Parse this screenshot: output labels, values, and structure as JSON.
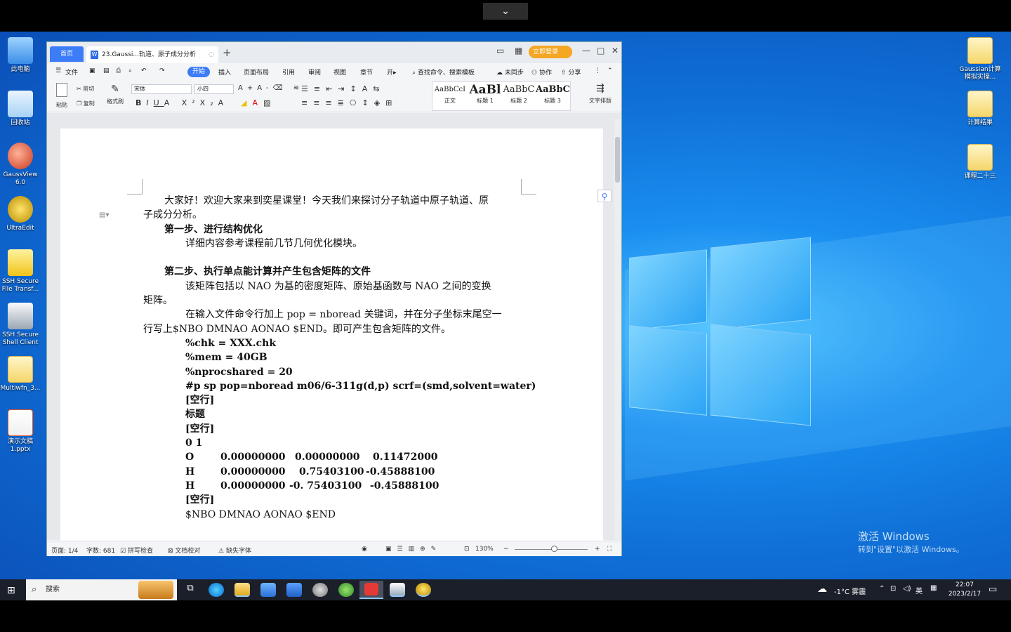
{
  "topbar": {
    "toggle_icon": "chevron-down-icon",
    "toggle_glyph": "⌄"
  },
  "desktop": {
    "icons_left": [
      {
        "label": "此电脑",
        "icon": "computer-icon",
        "color": "#5aa8ff"
      },
      {
        "label": "回收站",
        "icon": "recycle-bin-icon",
        "color": "#cfe8ff"
      },
      {
        "label": "GaussView 6.0",
        "icon": "gaussview-icon",
        "color": "#d84b2a"
      },
      {
        "label": "UltraEdit",
        "icon": "ultraedit-icon",
        "color": "#e6b800"
      },
      {
        "label": "SSH Secure File Transf...",
        "icon": "ssh-file-transfer-icon",
        "color": "#ffd84a"
      },
      {
        "label": "SSH Secure Shell Client",
        "icon": "ssh-shell-icon",
        "color": "#ddd"
      },
      {
        "label": "Multiwfn_3...",
        "icon": "folder-icon",
        "color": "#f5d66b"
      },
      {
        "label": "演示文稿1.pptx",
        "icon": "pptx-icon",
        "color": "#e55b2d"
      }
    ],
    "icons_right": [
      {
        "label": "Gaussian计算模拟实操...",
        "icon": "folder-icon"
      },
      {
        "label": "计算结果",
        "icon": "folder-icon"
      },
      {
        "label": "课程二十三",
        "icon": "folder-icon"
      }
    ],
    "watermark_title": "激活 Windows",
    "watermark_sub": "转到\"设置\"以激活 Windows。"
  },
  "wps": {
    "tabs": {
      "home": "首页",
      "doc_title": "23.Gaussi...轨道、原子成分分析",
      "doc_icon": "W",
      "close_glyph": "◌",
      "add_glyph": "+"
    },
    "titlebar": {
      "layout_icon": "▭",
      "grid_icon": "▦",
      "login": "立即登录",
      "minimize": "—",
      "maximize": "□",
      "close": "✕"
    },
    "menu": {
      "file": "文件",
      "items": [
        "开始",
        "插入",
        "页面布局",
        "引用",
        "审阅",
        "视图",
        "章节",
        "开▸"
      ],
      "search": "查找命令、搜索模板",
      "sync": "未同步",
      "collab": "协作",
      "share": "分享"
    },
    "ribbon": {
      "paste": "粘贴",
      "cut": "剪切",
      "copy": "复制",
      "format_painter": "格式刷",
      "font_name": "宋体",
      "font_size": "小四",
      "styles": [
        {
          "preview": "AaBbCcI",
          "name": "正文"
        },
        {
          "preview": "AaBl",
          "name": "标题 1"
        },
        {
          "preview": "AaBbC",
          "name": "标题 2"
        },
        {
          "preview": "AaBbC",
          "name": "标题 3"
        }
      ],
      "text_layout": "文字排版"
    },
    "document": {
      "intro_line1": "大家好！欢迎大家来到奕星课堂！今天我们来探讨分子轨道中原子轨道、原",
      "intro_line2": "子成分分析。",
      "step1_title": "第一步、进行结构优化",
      "step1_text": "详细内容参考课程前几节几何优化模块。",
      "step2_title": "第二步、执行单点能计算并产生包含矩阵的文件",
      "step2_line1": "该矩阵包括以 NAO 为基的密度矩阵、原始基函数与 NAO 之间的变换",
      "step2_line2": "矩阵。",
      "step2_line3": "在输入文件命令行加上 pop = nboread 关键词，并在分子坐标末尾空一",
      "step2_line4": "行写上$NBO DMNAO AONAO $END。即可产生包含矩阵的文件。",
      "code_lines": [
        "%chk = XXX.chk",
        "%mem = 40GB",
        "%nprocshared = 20",
        "#p sp pop=nboread m06/6-311g(d,p) scrf=(smd,solvent=water)",
        "[空行]",
        "标题",
        "[空行]",
        "0 1"
      ],
      "coords": [
        {
          "atom": "O",
          "x": "0.00000000",
          "y": "0.00000000",
          "z": "0.11472000"
        },
        {
          "atom": "H",
          "x": "0.00000000",
          "y": "0.75403100",
          "z": "-0.45888100"
        },
        {
          "atom": "H",
          "x": "0.00000000",
          "y": "-0. 75403100",
          "z": "-0.45888100"
        }
      ],
      "after_coords": "[空行]",
      "last_line": "$NBO DMNAO AONAO $END"
    },
    "status": {
      "page": "页面: 1/4",
      "words": "字数: 681",
      "spell": "拼写检查",
      "proof": "文档校对",
      "missing_font": "缺失字体",
      "zoom": "130%"
    }
  },
  "taskbar": {
    "search_placeholder": "搜索",
    "weather": "-1°C 雾霾",
    "lang": "英",
    "time": "22:07",
    "date": "2023/2/17",
    "apps": [
      {
        "icon": "task-view-icon",
        "color": "#1b1f2a"
      },
      {
        "icon": "edge-icon",
        "color": "#1fa1e0"
      },
      {
        "icon": "file-explorer-icon",
        "color": "#f2c94c"
      },
      {
        "icon": "store-icon",
        "color": "#3b8ee8"
      },
      {
        "icon": "mail-icon",
        "color": "#2b79d0"
      },
      {
        "icon": "gaussview-icon",
        "color": "#a0a0a0"
      },
      {
        "icon": "green-app-icon",
        "color": "#4caf50"
      },
      {
        "icon": "wps-icon",
        "color": "#e53935"
      },
      {
        "icon": "ssh-icon",
        "color": "#9ab"
      },
      {
        "icon": "ultraedit-icon",
        "color": "#e6b800"
      }
    ]
  }
}
